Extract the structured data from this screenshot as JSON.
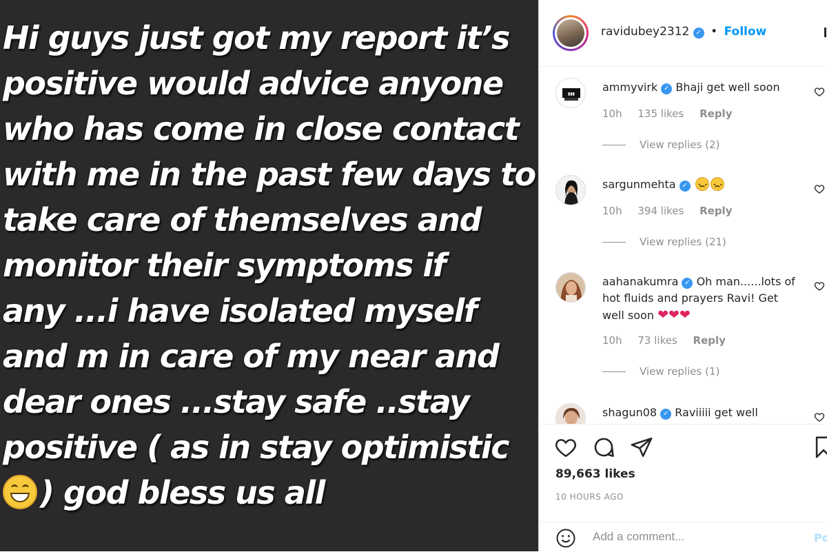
{
  "story": {
    "lines": [
      "Hi guys just got my report it’s",
      "positive would advice anyone",
      "who has come in close contact",
      "with me in the past few days to",
      "take care of themselves and",
      "monitor their symptoms if",
      "any ...i have isolated myself",
      "and m in care of my near and",
      "dear ones ...stay safe ..stay",
      "positive ( as in stay optimistic",
      ") god bless us all"
    ],
    "emoji_icon": "grinning-face-emoji"
  },
  "header": {
    "username": "ravidubey2312",
    "separator": "•",
    "follow_label": "Follow"
  },
  "comments": [
    {
      "username": "ammyvirk",
      "text": "Bhaji get well soon",
      "time": "10h",
      "likes": "135 likes",
      "reply_label": "Reply",
      "view_replies": "View replies (2)"
    },
    {
      "username": "sargunmehta",
      "text": "",
      "emoji": "sad-face-emoji x2",
      "time": "10h",
      "likes": "394 likes",
      "reply_label": "Reply",
      "view_replies": "View replies (21)"
    },
    {
      "username": "aahanakumra",
      "text": "Oh man......lots of hot fluids and prayers Ravi! Get well soon",
      "emoji": "red-heart-emoji x3",
      "hearts": "❤❤❤",
      "time": "10h",
      "likes": "73 likes",
      "reply_label": "Reply",
      "view_replies": "View replies (1)"
    },
    {
      "username": "shagun08",
      "text": "Raviiiii get well"
    }
  ],
  "actions": {
    "likes": "89,663 likes",
    "time_ago": "10 HOURS AGO"
  },
  "composer": {
    "placeholder": "Add a comment...",
    "post_label": "Post"
  },
  "colors": {
    "story_bg": "#2a2a2a",
    "link_blue": "#0095f6",
    "verified_blue": "#3897f0",
    "muted_gray": "#8e8e8e"
  }
}
